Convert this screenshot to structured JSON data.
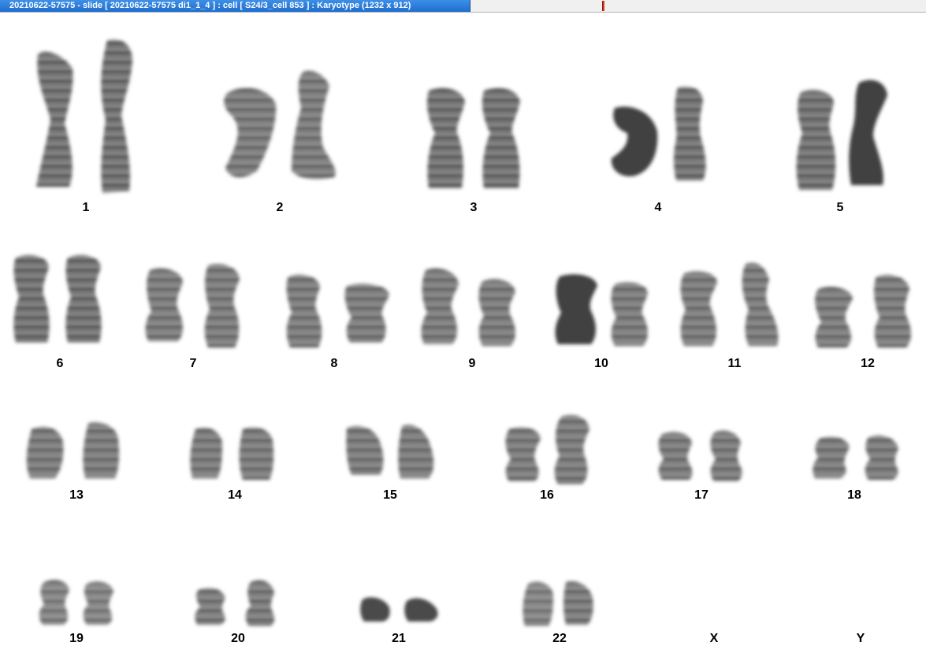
{
  "window": {
    "title": "20210622-57575 - slide [ 20210622-57575 di1_1_4 ] : cell [ S24/3_cell 853 ] : Karyotype  (1232 x 912)"
  },
  "colors": {
    "chromatin": "#1a1a1a",
    "background": "#ffffff",
    "title_active": "#2a7bd8"
  },
  "karyotype": {
    "labels": {
      "c1": "1",
      "c2": "2",
      "c3": "3",
      "c4": "4",
      "c5": "5",
      "c6": "6",
      "c7": "7",
      "c8": "8",
      "c9": "9",
      "c10": "10",
      "c11": "11",
      "c12": "12",
      "c13": "13",
      "c14": "14",
      "c15": "15",
      "c16": "16",
      "c17": "17",
      "c18": "18",
      "c19": "19",
      "c20": "20",
      "c21": "21",
      "c22": "22",
      "cX": "X",
      "cY": "Y"
    }
  }
}
